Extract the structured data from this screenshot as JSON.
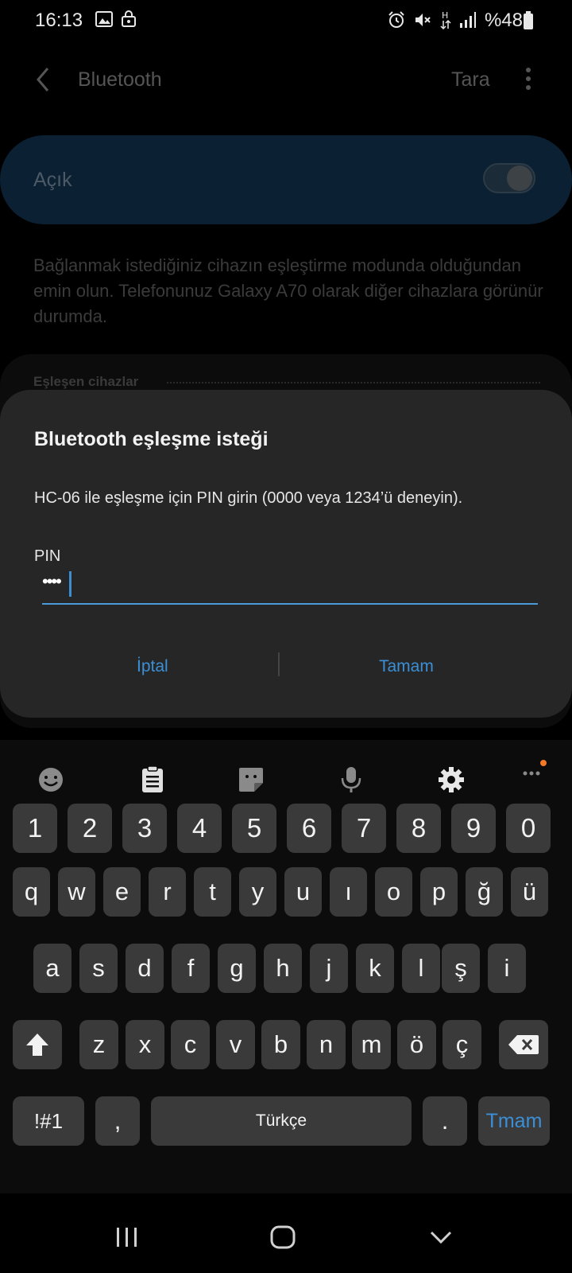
{
  "status": {
    "time": "16:13",
    "battery": "%48",
    "left_icons": [
      "image-icon",
      "lock-icon"
    ],
    "right_icons": [
      "alarm-icon",
      "mute-icon",
      "data-h-icon",
      "signal-icon",
      "battery-icon"
    ]
  },
  "header": {
    "title": "Bluetooth",
    "scan_label": "Tara"
  },
  "toggle": {
    "label": "Açık",
    "state": "on"
  },
  "hint_text": "Bağlanmak istediğiniz cihazın eşleştirme modunda olduğundan emin olun. Telefonunuz Galaxy A70 olarak diğer cihazlara görünür durumda.",
  "paired_section_title": "Eşleşen cihazlar",
  "dialog": {
    "title": "Bluetooth eşleşme isteği",
    "message": "HC-06 ile eşleşme için PIN girin (0000 veya 1234’ü deneyin).",
    "pin_label": "PIN",
    "pin_value": "••••",
    "cancel_label": "İptal",
    "ok_label": "Tamam"
  },
  "keyboard": {
    "toolbar_icons": [
      "emoji-icon",
      "clipboard-icon",
      "sticker-icon",
      "microphone-icon",
      "settings-icon",
      "more-icon"
    ],
    "number_row": [
      "1",
      "2",
      "3",
      "4",
      "5",
      "6",
      "7",
      "8",
      "9",
      "0"
    ],
    "row1": [
      "q",
      "w",
      "e",
      "r",
      "t",
      "y",
      "u",
      "ı",
      "o",
      "p",
      "ğ",
      "ü"
    ],
    "row2": [
      "a",
      "s",
      "d",
      "f",
      "g",
      "h",
      "j",
      "k",
      "l",
      "ş",
      "i"
    ],
    "row3": [
      "z",
      "x",
      "c",
      "v",
      "b",
      "n",
      "m",
      "ö",
      "ç"
    ],
    "symbols_label": "!#1",
    "comma_label": ",",
    "space_label": "Türkçe",
    "period_label": ".",
    "enter_label": "Tmam"
  },
  "colors": {
    "accent": "#3a8fd6",
    "dialog_bg": "#262626",
    "key_bg": "#3a3a3a",
    "toggle_card": "#0b2033"
  }
}
